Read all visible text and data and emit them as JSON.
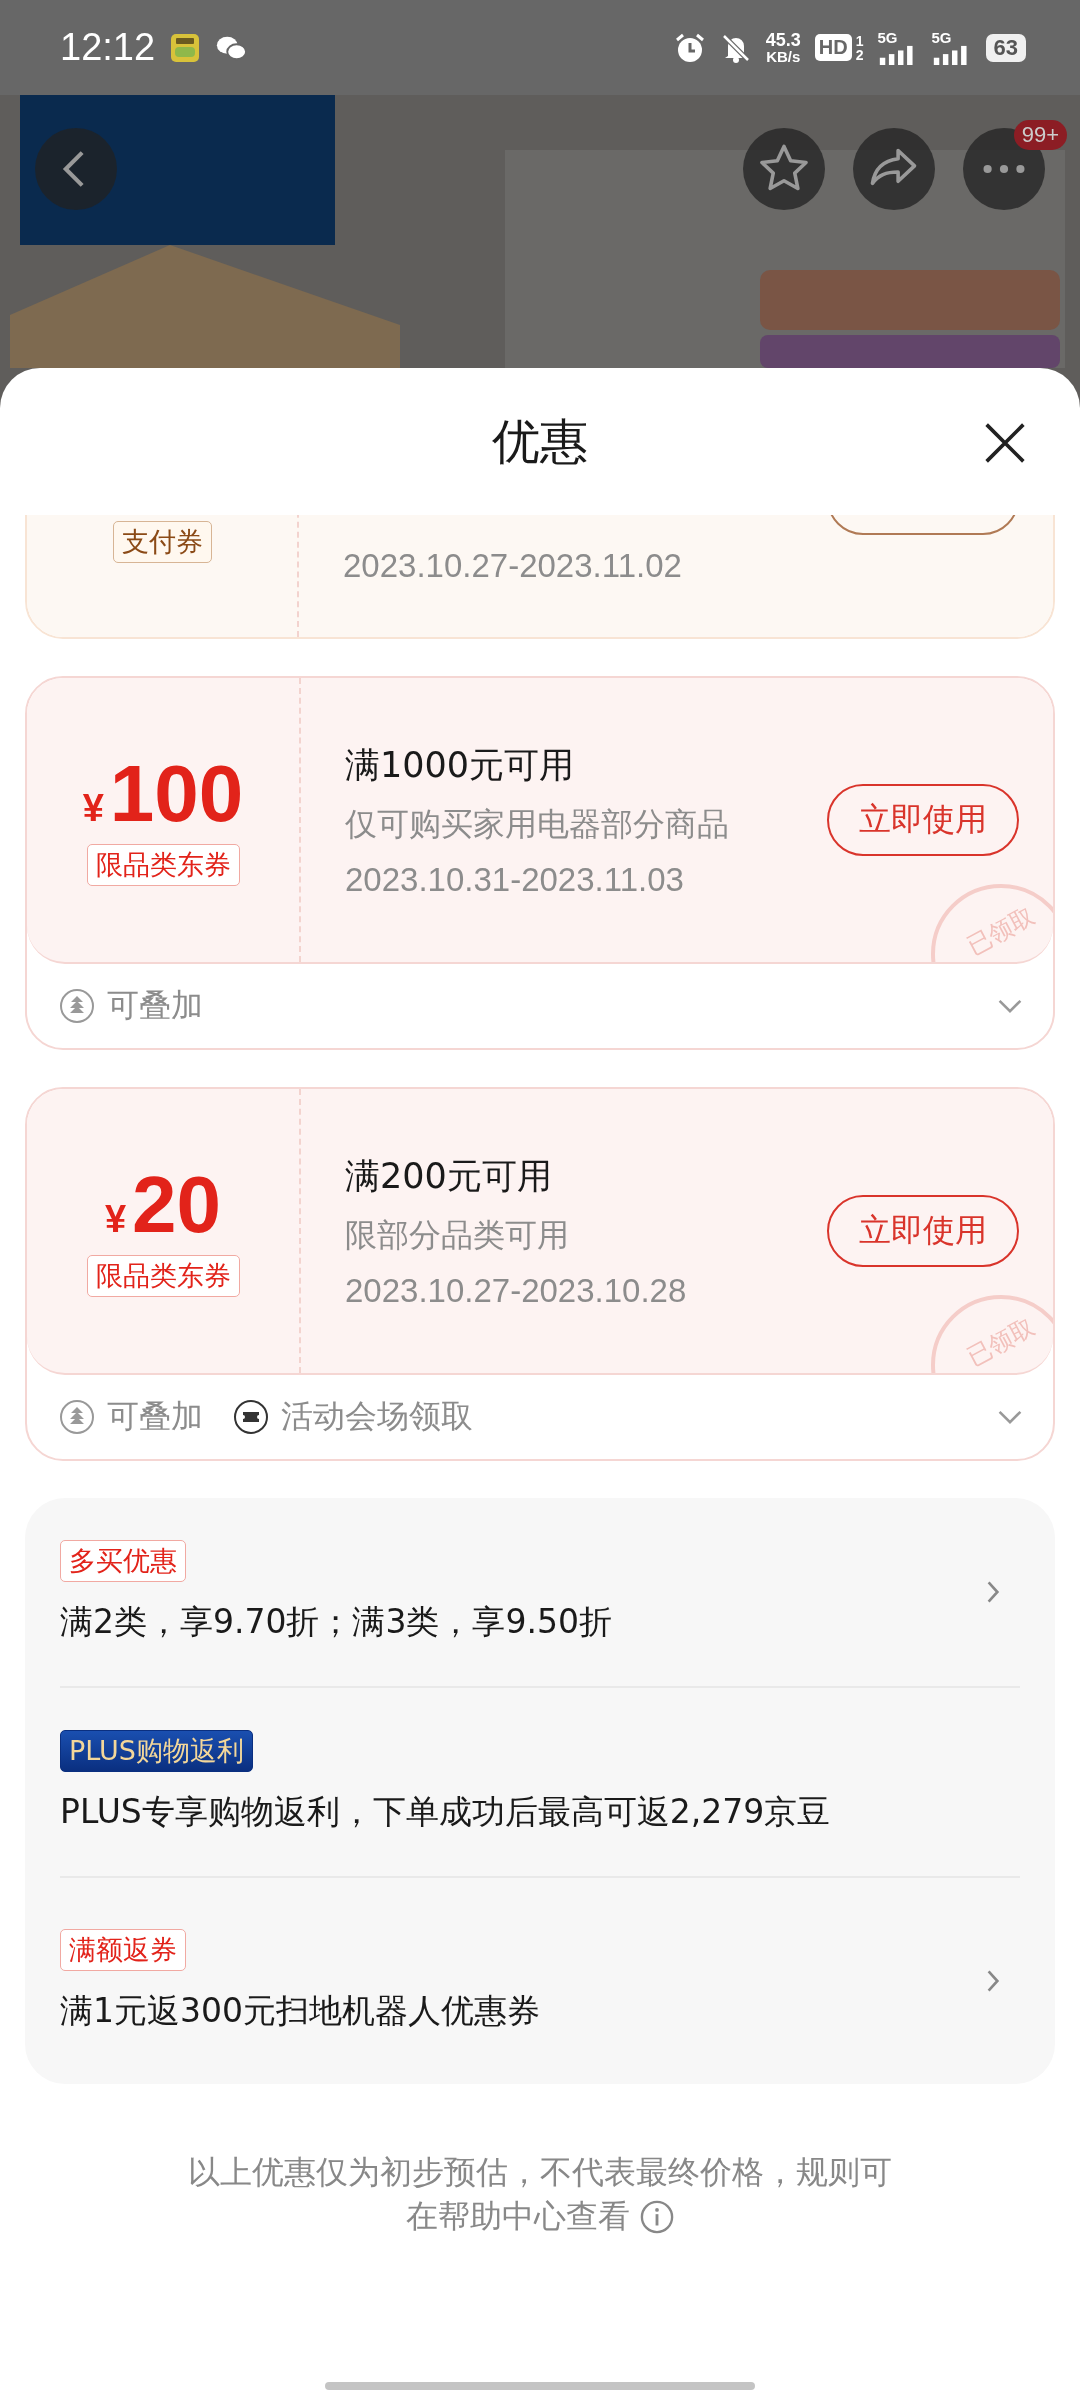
{
  "status_bar": {
    "time": "12:12",
    "speed": "45.3",
    "speed_unit": "KB/s",
    "hd": "HD",
    "sims": [
      "1",
      "2"
    ],
    "networks": [
      "5G",
      "5G"
    ],
    "battery": "63"
  },
  "top_bar": {
    "badge": "99+"
  },
  "sheet": {
    "title": "优惠"
  },
  "coupons": [
    {
      "kind": "payment",
      "clipped": true,
      "tag": "支付券",
      "dates": "2023.10.27-2023.11.02"
    },
    {
      "kind": "category",
      "clipped": false,
      "currency": "¥",
      "amount": "100",
      "tag": "限品类东券",
      "title": "满1000元可用",
      "desc": "仅可购买家用电器部分商品",
      "dates": "2023.10.31-2023.11.03",
      "action": "立即使用",
      "stamp": "已领取",
      "features": [
        {
          "kind": "stack",
          "label": "可叠加"
        }
      ]
    },
    {
      "kind": "category",
      "clipped": false,
      "currency": "¥",
      "amount": "20",
      "tag": "限品类东券",
      "title": "满200元可用",
      "desc": "限部分品类可用",
      "dates": "2023.10.27-2023.10.28",
      "action": "立即使用",
      "stamp": "已领取",
      "features": [
        {
          "kind": "stack",
          "label": "可叠加"
        },
        {
          "kind": "venue",
          "label": "活动会场领取"
        }
      ]
    }
  ],
  "promotions": [
    {
      "kind": "red",
      "tag": "多买优惠",
      "text": "满2类，享9.70折；满3类，享9.50折",
      "arrow": true
    },
    {
      "kind": "plus",
      "tag": "PLUS购物返利",
      "text": "PLUS专享购物返利，下单成功后最高可返2,279京豆",
      "arrow": false
    },
    {
      "kind": "red",
      "tag": "满额返券",
      "text": "满1元返300元扫地机器人优惠券",
      "arrow": true
    }
  ],
  "note": [
    "以上优惠仅为初步预估，不代表最终价格，规则可",
    "在帮助中心查看"
  ]
}
